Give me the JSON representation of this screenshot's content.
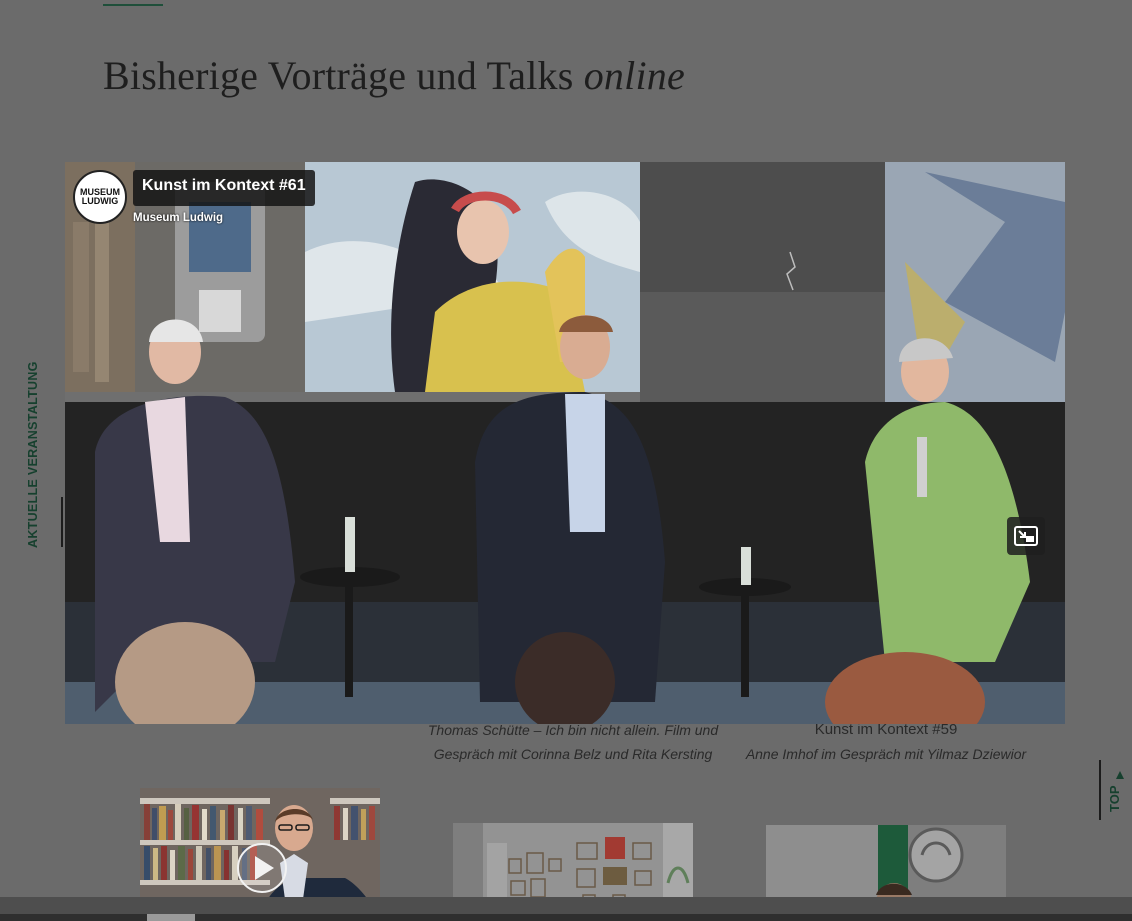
{
  "section": {
    "heading_main": "Bisherige Vorträge und Talks",
    "heading_italic": "online"
  },
  "side_label": "AKTUELLE VERANSTALTUNG",
  "video": {
    "logo_line1": "MUSEUM",
    "logo_line2": "LUDWIG",
    "title": "Kunst im Kontext #61",
    "channel": "Museum Ludwig",
    "pip_icon": "picture-in-picture-icon"
  },
  "captions": [
    {
      "line1": "Thomas Schütte – Ich bin nicht allein. Film und",
      "line2": "Gespräch mit Corinna Belz und Rita Kersting"
    },
    {
      "line1": "Kunst im Kontext #59",
      "line2": "Anne Imhof im Gespräch mit Yilmaz Dziewior"
    }
  ],
  "top_button": {
    "label": "TOP",
    "icon": "arrow-up-icon"
  },
  "colors": {
    "accent": "#16402e",
    "overlay_bg": "#6b6b6b"
  }
}
